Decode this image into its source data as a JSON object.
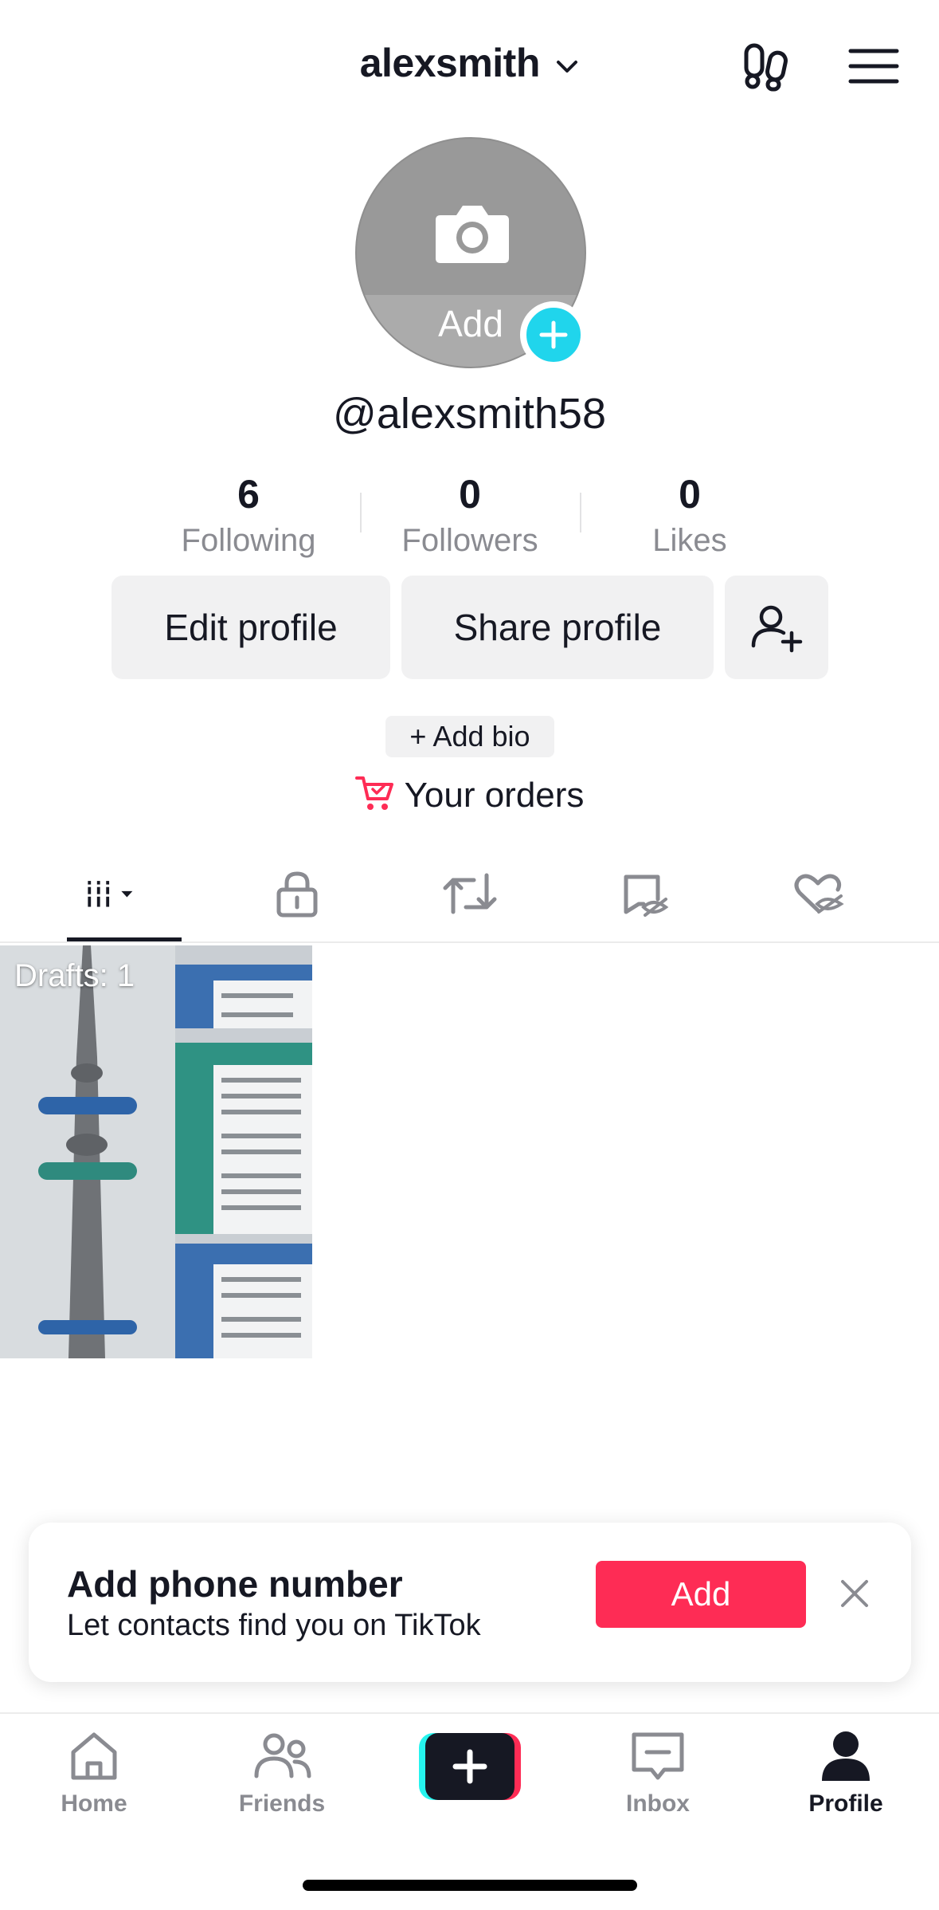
{
  "header": {
    "username": "alexsmith",
    "icons": [
      "chevron-down-icon",
      "footprints-icon",
      "menu-icon"
    ]
  },
  "profile": {
    "avatar_add_label": "Add",
    "handle": "@alexsmith58",
    "stats": [
      {
        "value": "6",
        "label": "Following"
      },
      {
        "value": "0",
        "label": "Followers"
      },
      {
        "value": "0",
        "label": "Likes"
      }
    ],
    "edit_label": "Edit profile",
    "share_label": "Share profile",
    "add_bio_label": "+ Add bio",
    "orders_label": "Your orders"
  },
  "tabs": [
    "videos-grid-icon",
    "private-lock-icon",
    "reposts-icon",
    "favorites-hidden-icon",
    "liked-hidden-icon"
  ],
  "draft": {
    "label": "Drafts: 1"
  },
  "phone_card": {
    "title": "Add phone number",
    "subtitle": "Let contacts find you on TikTok",
    "button_label": "Add"
  },
  "nav": {
    "home": "Home",
    "friends": "Friends",
    "inbox": "Inbox",
    "profile": "Profile"
  },
  "colors": {
    "accent": "#fe2c55",
    "badge": "#20d5ec",
    "muted": "#8a8b91"
  }
}
